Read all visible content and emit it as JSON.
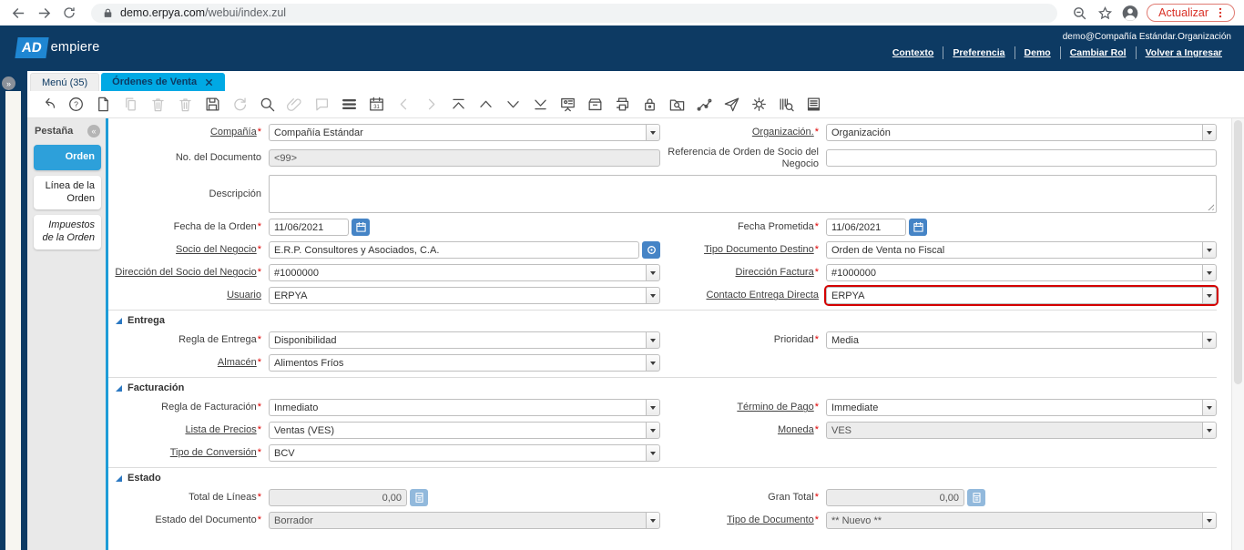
{
  "colors": {
    "navy": "#0d3a63",
    "azure": "#00a9e4",
    "tabblue": "#2da0da",
    "bluebar": "#1e9cd7",
    "logoblue": "#1f86d2",
    "btnblue": "#4584c6",
    "btnlblue": "#92b9dc",
    "sectblue": "#2b78c2",
    "chromered": "#d93025"
  },
  "browser": {
    "url_domain": "demo.erpya.com",
    "url_path": "/webui/index.zul",
    "update_label": "Actualizar"
  },
  "header": {
    "logo_ad": "AD",
    "logo_rest": "empiere",
    "user_context": "demo@Compañía Estándar.Organización",
    "links": [
      "Contexto",
      "Preferencia",
      "Demo",
      "Cambiar Rol",
      "Volver a Ingresar"
    ]
  },
  "tabs": {
    "menu": "Menú (35)",
    "active": "Órdenes de Venta"
  },
  "rail": {
    "expand_icon": "»"
  },
  "toolbar": {
    "items": [
      {
        "name": "undo",
        "icon": "undo",
        "disabled": false
      },
      {
        "name": "help",
        "icon": "help",
        "disabled": false
      },
      {
        "name": "new-record",
        "icon": "newdoc",
        "disabled": false
      },
      {
        "name": "copy-record",
        "icon": "copy",
        "disabled": true
      },
      {
        "name": "delete-record",
        "icon": "trash",
        "disabled": true
      },
      {
        "name": "delete-selection",
        "icon": "trash",
        "disabled": true
      },
      {
        "name": "save",
        "icon": "save",
        "disabled": false
      },
      {
        "name": "refresh",
        "icon": "refresh",
        "disabled": true
      },
      {
        "name": "find",
        "icon": "find",
        "disabled": false
      },
      {
        "name": "attachment",
        "icon": "clip",
        "disabled": true
      },
      {
        "name": "chat",
        "icon": "chat",
        "disabled": true
      },
      {
        "name": "grid-toggle",
        "icon": "bars",
        "disabled": false
      },
      {
        "name": "calendar",
        "icon": "cal31",
        "disabled": false
      },
      {
        "name": "parent-record",
        "icon": "chevl",
        "disabled": true
      },
      {
        "name": "detail-record",
        "icon": "chevr",
        "disabled": true
      },
      {
        "name": "first-record",
        "icon": "first",
        "disabled": false
      },
      {
        "name": "previous-record",
        "icon": "prev",
        "disabled": false
      },
      {
        "name": "next-record",
        "icon": "next",
        "disabled": false
      },
      {
        "name": "last-record",
        "icon": "last",
        "disabled": false
      },
      {
        "name": "report",
        "icon": "board",
        "disabled": false
      },
      {
        "name": "archive",
        "icon": "archive",
        "disabled": false
      },
      {
        "name": "print",
        "icon": "print",
        "disabled": false
      },
      {
        "name": "lock",
        "icon": "lock",
        "disabled": false
      },
      {
        "name": "zoom-across",
        "icon": "zoomacross",
        "disabled": false
      },
      {
        "name": "workflow",
        "icon": "workflow",
        "disabled": false
      },
      {
        "name": "request",
        "icon": "send",
        "disabled": false
      },
      {
        "name": "preference",
        "icon": "gear",
        "disabled": false
      },
      {
        "name": "product-info",
        "icon": "barcode",
        "disabled": false
      },
      {
        "name": "print-preview",
        "icon": "reportdoc",
        "disabled": false
      }
    ]
  },
  "sidebar": {
    "title": "Pestaña",
    "collapse_icon": "«",
    "tabs": [
      {
        "label": "Orden",
        "active": true,
        "italic": false
      },
      {
        "label": "Línea de la Orden",
        "active": false,
        "italic": false
      },
      {
        "label": "Impuestos de la Orden",
        "active": false,
        "italic": true
      }
    ]
  },
  "form": {
    "sections": [
      {
        "title": "",
        "rows": [
          [
            {
              "name": "compania",
              "label": "Compañía",
              "required": true,
              "link": true,
              "control": "combo",
              "value": "Compañía Estándar"
            },
            {
              "name": "organizacion",
              "label": "Organización.",
              "required": true,
              "link": true,
              "control": "combo",
              "value": "Organización"
            }
          ],
          [
            {
              "name": "no-documento",
              "label": "No. del Documento",
              "required": false,
              "link": false,
              "control": "readonly",
              "value": "<99>"
            },
            {
              "name": "referencia-orden-socio",
              "label": "Referencia de Orden de Socio del Negocio",
              "required": false,
              "link": false,
              "control": "text",
              "value": ""
            }
          ],
          [
            {
              "name": "descripcion",
              "label": "Descripción",
              "required": false,
              "link": false,
              "control": "textarea",
              "value": "",
              "span": 2
            }
          ],
          [
            {
              "name": "fecha-orden",
              "label": "Fecha de la Orden",
              "required": true,
              "link": false,
              "control": "date",
              "value": "11/06/2021"
            },
            {
              "name": "fecha-prometida",
              "label": "Fecha Prometida",
              "required": true,
              "link": false,
              "control": "date",
              "value": "11/06/2021"
            }
          ],
          [
            {
              "name": "socio-negocio",
              "label": "Socio del Negocio",
              "required": true,
              "link": true,
              "control": "search",
              "value": "E.R.P. Consultores y Asociados, C.A."
            },
            {
              "name": "tipo-documento-destino",
              "label": "Tipo Documento Destino",
              "required": true,
              "link": true,
              "control": "combo",
              "value": "Orden de Venta no Fiscal"
            }
          ],
          [
            {
              "name": "direccion-socio-negocio",
              "label": "Dirección del Socio del Negocio",
              "required": true,
              "link": true,
              "control": "combo",
              "value": "#1000000"
            },
            {
              "name": "direccion-factura",
              "label": "Dirección Factura",
              "required": true,
              "link": true,
              "control": "combo",
              "value": "#1000000"
            }
          ],
          [
            {
              "name": "usuario",
              "label": "Usuario",
              "required": false,
              "link": true,
              "control": "combo",
              "value": "ERPYA"
            },
            {
              "name": "contacto-entrega-directa",
              "label": "Contacto Entrega Directa",
              "required": false,
              "link": true,
              "control": "combo",
              "value": "ERPYA",
              "highlight": true
            }
          ]
        ]
      },
      {
        "title": "Entrega",
        "rows": [
          [
            {
              "name": "regla-entrega",
              "label": "Regla de Entrega",
              "required": true,
              "link": false,
              "control": "combo",
              "value": "Disponibilidad"
            },
            {
              "name": "prioridad",
              "label": "Prioridad",
              "required": true,
              "link": false,
              "control": "combo",
              "value": "Media"
            }
          ],
          [
            {
              "name": "almacen",
              "label": "Almacén",
              "required": true,
              "link": true,
              "control": "combo",
              "value": "Alimentos Fríos"
            },
            null
          ]
        ]
      },
      {
        "title": "Facturación",
        "rows": [
          [
            {
              "name": "regla-facturacion",
              "label": "Regla de Facturación",
              "required": true,
              "link": false,
              "control": "combo",
              "value": "Inmediato"
            },
            {
              "name": "termino-pago",
              "label": "Término de Pago",
              "required": true,
              "link": true,
              "control": "combo",
              "value": "Immediate"
            }
          ],
          [
            {
              "name": "lista-precios",
              "label": "Lista de Precios",
              "required": true,
              "link": true,
              "control": "combo",
              "value": "Ventas (VES)"
            },
            {
              "name": "moneda",
              "label": "Moneda",
              "required": true,
              "link": true,
              "control": "combo",
              "value": "VES",
              "readonly": true
            }
          ],
          [
            {
              "name": "tipo-conversion",
              "label": "Tipo de Conversión",
              "required": true,
              "link": true,
              "control": "combo",
              "value": "BCV"
            },
            null
          ]
        ]
      },
      {
        "title": "Estado",
        "rows": [
          [
            {
              "name": "total-lineas",
              "label": "Total de Líneas",
              "required": true,
              "link": false,
              "control": "amount",
              "value": "0,00"
            },
            {
              "name": "gran-total",
              "label": "Gran Total",
              "required": true,
              "link": false,
              "control": "amount",
              "value": "0,00"
            }
          ],
          [
            {
              "name": "estado-documento",
              "label": "Estado del Documento",
              "required": true,
              "link": false,
              "control": "combo",
              "value": "Borrador",
              "readonly": true
            },
            {
              "name": "tipo-documento",
              "label": "Tipo de Documento",
              "required": true,
              "link": true,
              "control": "combo",
              "value": "** Nuevo **",
              "readonly": true
            }
          ]
        ]
      }
    ]
  }
}
